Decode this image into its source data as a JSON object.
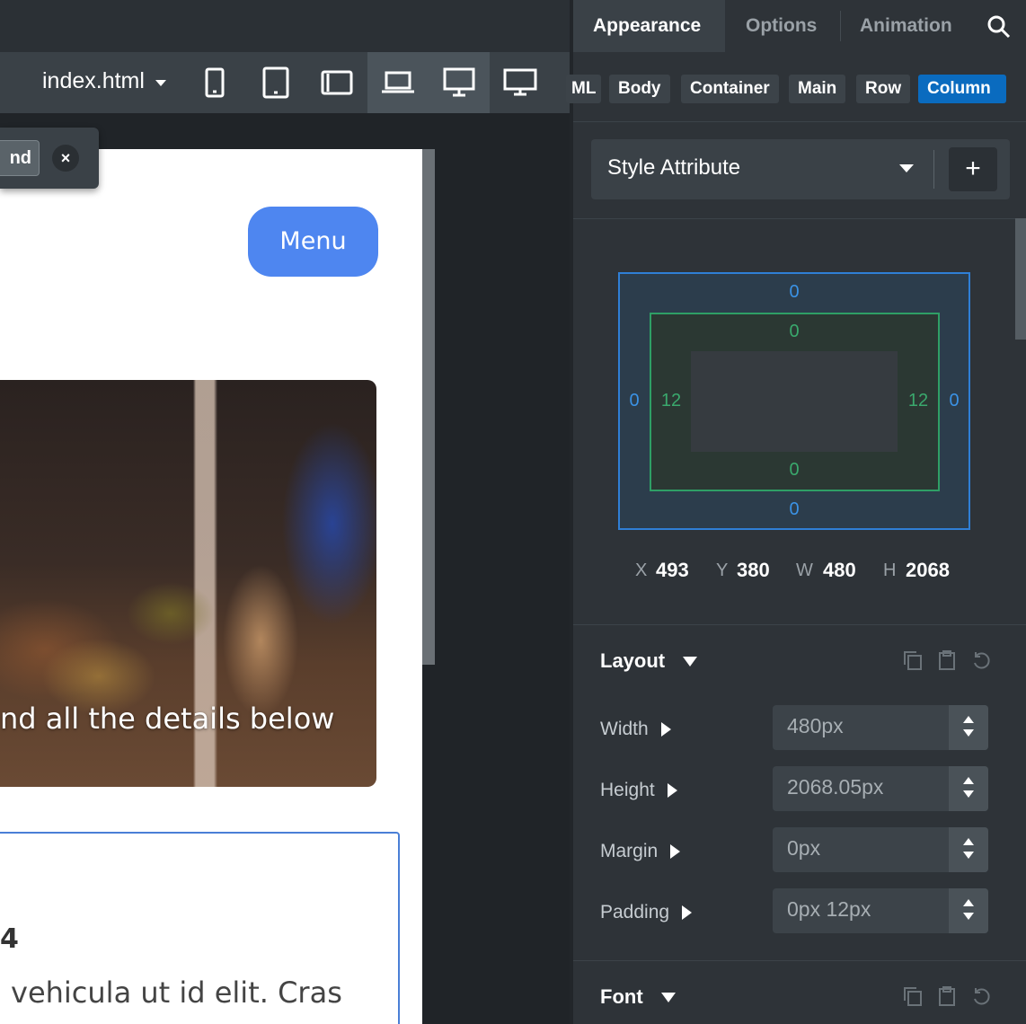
{
  "toolbar": {
    "file_name": "index.html",
    "devices": [
      "phone-icon",
      "tablet-icon",
      "tablet-landscape-icon",
      "laptop-icon",
      "desktop-icon",
      "monitor-icon"
    ],
    "active_device": "laptop-icon"
  },
  "canvas": {
    "selector_chip_label": "nd",
    "close_label": "×",
    "menu_button": "Menu",
    "hero_text": "nd all the details below",
    "card_number": "4",
    "card_text": "vehicula ut id elit. Cras"
  },
  "panel": {
    "tabs": [
      {
        "label": "Appearance",
        "active": true
      },
      {
        "label": "Options",
        "active": false
      },
      {
        "label": "Animation",
        "active": false
      }
    ],
    "breadcrumbs": [
      "ML",
      "Body",
      "Container",
      "Main",
      "Row",
      "Column"
    ],
    "active_breadcrumb": "Column",
    "style_select": "Style Attribute",
    "add_label": "+",
    "box_model": {
      "margin_top": "0",
      "margin_right": "0",
      "margin_bottom": "0",
      "margin_left": "0",
      "padding_top": "0",
      "padding_right": "12",
      "padding_bottom": "0",
      "padding_left": "12"
    },
    "coords": {
      "x_label": "X",
      "x": "493",
      "y_label": "Y",
      "y": "380",
      "w_label": "W",
      "w": "480",
      "h_label": "H",
      "h": "2068"
    },
    "layout": {
      "title": "Layout",
      "props": [
        {
          "label": "Width",
          "value": "480px"
        },
        {
          "label": "Height",
          "value": "2068.05px"
        },
        {
          "label": "Margin",
          "value": "0px"
        },
        {
          "label": "Padding",
          "value": "0px 12px"
        }
      ]
    },
    "font": {
      "title": "Font"
    }
  },
  "colors": {
    "accent_blue": "#0a6bbf",
    "menu_button": "#4e86f0",
    "margin_box": "#2f7fd6",
    "padding_box": "#2f9f66"
  }
}
